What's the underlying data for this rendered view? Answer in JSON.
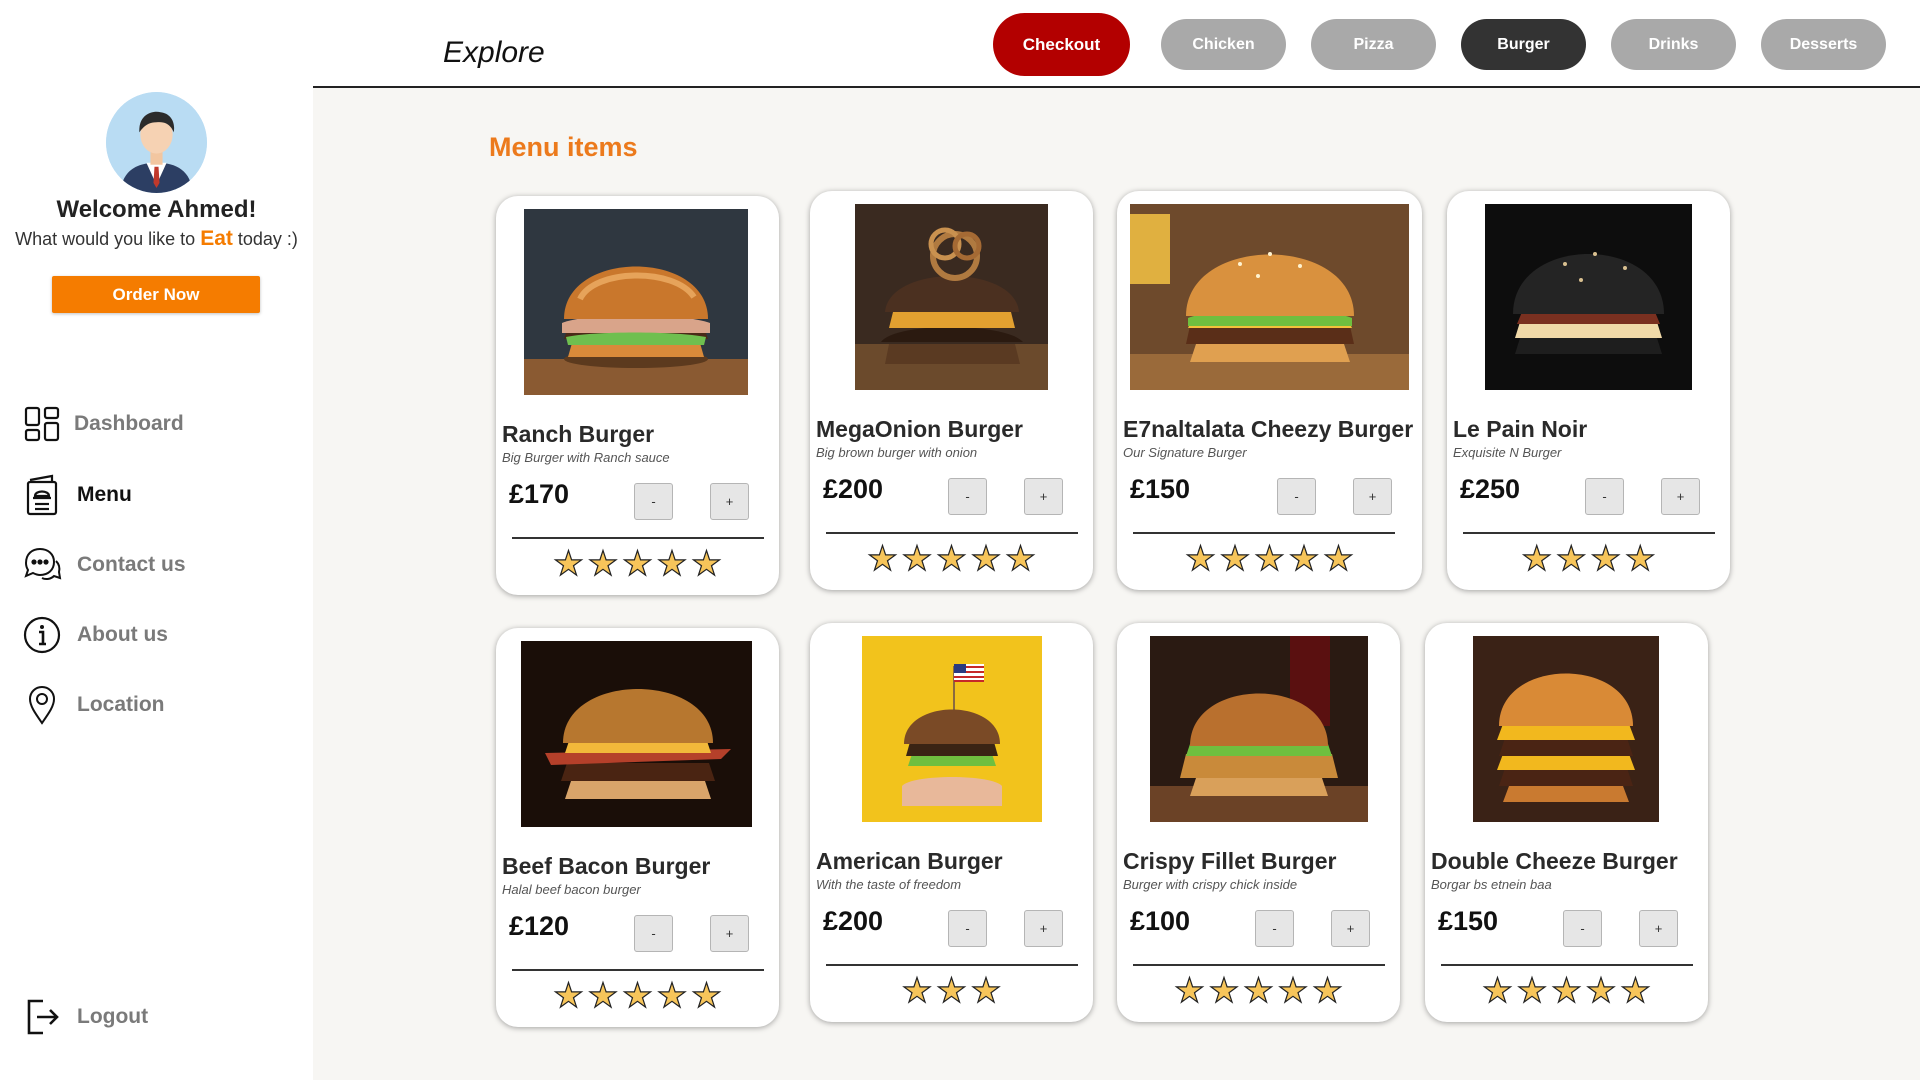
{
  "sidebar": {
    "welcome": "Welcome Ahmed!",
    "subtitle_before": "What would you like to ",
    "subtitle_highlight": "Eat",
    "subtitle_after": " today :)",
    "order_button": "Order Now",
    "nav": {
      "dashboard": "Dashboard",
      "menu": "Menu",
      "contact": "Contact us",
      "about": "About us",
      "location": "Location",
      "logout": "Logout"
    }
  },
  "header": {
    "title": "Explore",
    "checkout": "Checkout",
    "categories": [
      "Chicken",
      "Pizza",
      "Burger",
      "Drinks",
      "Desserts"
    ],
    "active_category": "Burger"
  },
  "main": {
    "section_title": "Menu items",
    "qty_minus": "-",
    "qty_plus": "+",
    "items": [
      {
        "name": "Ranch Burger",
        "desc": "Big Burger with Ranch sauce",
        "price": "£170",
        "rating": 5
      },
      {
        "name": "MegaOnion Burger",
        "desc": "Big brown burger with onion",
        "price": "£200",
        "rating": 5
      },
      {
        "name": "E7naltalata Cheezy Burger",
        "desc": "Our Signature Burger",
        "price": "£150",
        "rating": 5
      },
      {
        "name": "Le Pain Noir",
        "desc": "Exquisite N Burger",
        "price": "£250",
        "rating": 4
      },
      {
        "name": "Beef Bacon Burger",
        "desc": "Halal beef bacon burger",
        "price": "£120",
        "rating": 5
      },
      {
        "name": "American Burger",
        "desc": "With the taste of freedom",
        "price": "£200",
        "rating": 3
      },
      {
        "name": "Crispy Fillet Burger",
        "desc": "Burger with crispy chick inside",
        "price": "£100",
        "rating": 5
      },
      {
        "name": "Double Cheeze Burger",
        "desc": "Borgar bs etnein baa",
        "price": "£150",
        "rating": 5
      }
    ]
  },
  "colors": {
    "accent_orange": "#f57c00",
    "checkout_red": "#b30000",
    "category_grey": "#a9a9a9",
    "category_active": "#333333",
    "star_yellow": "#f7c55a"
  }
}
